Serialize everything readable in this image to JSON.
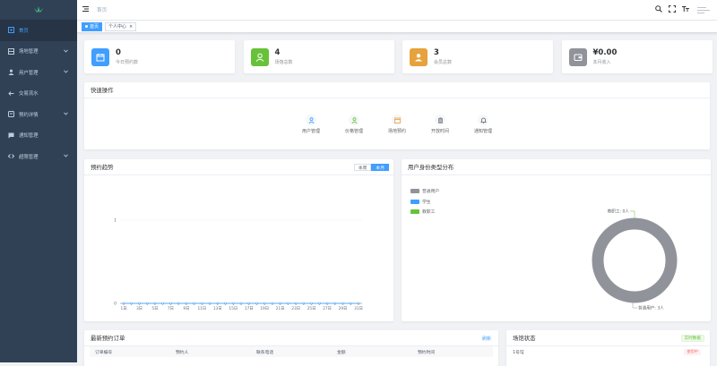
{
  "sidebar": {
    "items": [
      {
        "label": "首页",
        "icon": "home-icon",
        "active": true,
        "expandable": false
      },
      {
        "label": "场地管理",
        "icon": "table-icon",
        "active": false,
        "expandable": true
      },
      {
        "label": "用户管理",
        "icon": "user-icon",
        "active": false,
        "expandable": true
      },
      {
        "label": "交易流水",
        "icon": "back-arrow-icon",
        "active": false,
        "expandable": false
      },
      {
        "label": "预约详情",
        "icon": "chart-icon",
        "active": false,
        "expandable": true
      },
      {
        "label": "通知管理",
        "icon": "message-icon",
        "active": false,
        "expandable": false
      },
      {
        "label": "超限管理",
        "icon": "code-icon",
        "active": false,
        "expandable": true
      }
    ]
  },
  "navbar": {
    "breadcrumb": "首页"
  },
  "tags": [
    {
      "label": "首页",
      "active": true
    },
    {
      "label": "个人中心",
      "active": false
    }
  ],
  "stats": [
    {
      "value": "0",
      "label": "今日预约数",
      "color": "#409eff",
      "icon": "calendar-icon"
    },
    {
      "value": "4",
      "label": "场馆总数",
      "color": "#67c23a",
      "icon": "user-icon"
    },
    {
      "value": "3",
      "label": "会员总数",
      "color": "#e6a23c",
      "icon": "member-icon"
    },
    {
      "value": "¥0.00",
      "label": "本月收入",
      "color": "#909399",
      "icon": "wallet-icon"
    }
  ],
  "quick": {
    "title": "快速操作",
    "items": [
      {
        "label": "用户管理",
        "icon": "user-icon",
        "color": "#409eff"
      },
      {
        "label": "价格管理",
        "icon": "user-icon",
        "color": "#67c23a"
      },
      {
        "label": "场地预约",
        "icon": "calendar-icon",
        "color": "#e6a23c"
      },
      {
        "label": "开放时间",
        "icon": "clipboard-icon",
        "color": "#909399"
      },
      {
        "label": "通知管理",
        "icon": "bell-icon",
        "color": "#606266"
      }
    ]
  },
  "trend": {
    "title": "预约趋势",
    "toggle": [
      "本周",
      "本月"
    ],
    "toggle_active": 1
  },
  "identity": {
    "title": "用户身份类型分布",
    "legend": [
      "普通用户",
      "学生",
      "教职工"
    ],
    "callout_top": "教职工: 0人",
    "callout_bottom": "普通用户: 3人"
  },
  "orders": {
    "title": "最新预约订单",
    "refresh": "刷新",
    "columns": [
      "订单编号",
      "预约人",
      "联系电话",
      "金额",
      "预约时间"
    ]
  },
  "venue": {
    "title": "场馆状态",
    "badge": "实时数据",
    "rows": [
      {
        "name": "1号馆",
        "status": "使用中"
      }
    ]
  },
  "chart_data": [
    {
      "type": "line",
      "title": "预约趋势",
      "categories": [
        "1日",
        "2日",
        "3日",
        "4日",
        "5日",
        "6日",
        "7日",
        "8日",
        "9日",
        "10日",
        "11日",
        "12日",
        "13日",
        "14日",
        "15日",
        "16日",
        "17日",
        "18日",
        "19日",
        "20日",
        "21日",
        "22日",
        "23日",
        "24日",
        "25日",
        "26日",
        "27日",
        "28日",
        "29日",
        "30日",
        "31日"
      ],
      "tick_labels": [
        "1日",
        "3日",
        "5日",
        "7日",
        "9日",
        "11日",
        "13日",
        "15日",
        "17日",
        "19日",
        "21日",
        "23日",
        "25日",
        "27日",
        "29日",
        "31日"
      ],
      "series": [
        {
          "values": [
            0,
            0,
            0,
            0,
            0,
            0,
            0,
            0,
            0,
            0,
            0,
            0,
            0,
            0,
            0,
            0,
            0,
            0,
            0,
            0,
            0,
            0,
            0,
            0,
            0,
            0,
            0,
            0,
            0,
            0,
            0
          ]
        }
      ],
      "ylim": [
        0,
        1
      ],
      "yticks": [
        "0",
        "1"
      ],
      "color": "#409eff"
    },
    {
      "type": "pie",
      "title": "用户身份类型分布",
      "labels": [
        "普通用户",
        "学生",
        "教职工"
      ],
      "values": [
        3,
        0,
        0
      ],
      "colors": [
        "#909399",
        "#409eff",
        "#67c23a"
      ]
    }
  ]
}
